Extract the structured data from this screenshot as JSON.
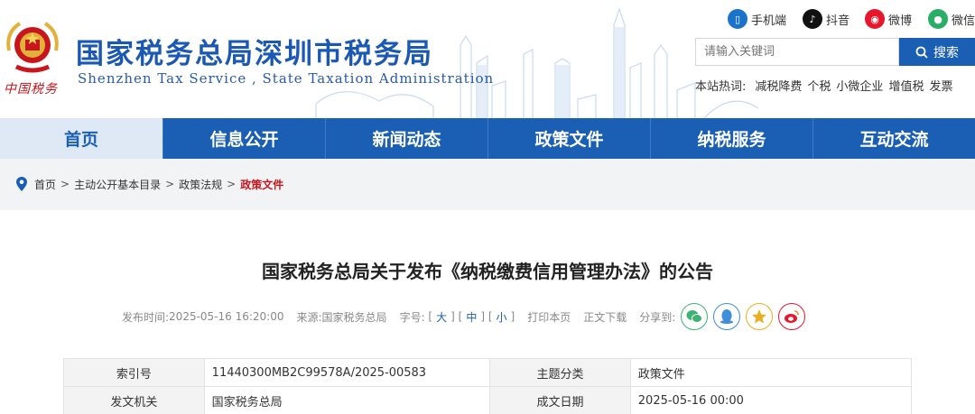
{
  "header": {
    "title": "国家税务总局深圳市税务局",
    "subtitle": "Shenzhen Tax Service , State Taxation Administration",
    "emblem_text": "中国税务",
    "social": [
      {
        "label": "手机端",
        "icon": "mobile-icon"
      },
      {
        "label": "抖音",
        "icon": "douyin-icon"
      },
      {
        "label": "微博",
        "icon": "weibo-icon"
      },
      {
        "label": "微信",
        "icon": "wechat-icon"
      }
    ],
    "search": {
      "placeholder": "请输入关键词",
      "button": "搜索"
    },
    "hot": {
      "label": "本站热词:",
      "items": [
        "减税降费",
        "个税",
        "小微企业",
        "增值税",
        "发票"
      ]
    }
  },
  "nav": {
    "items": [
      "首页",
      "信息公开",
      "新闻动态",
      "政策文件",
      "纳税服务",
      "互动交流"
    ],
    "active_index": 0
  },
  "breadcrumb": {
    "items": [
      "首页",
      "主动公开基本目录",
      "政策法规"
    ],
    "current": "政策文件",
    "separator": ">"
  },
  "article": {
    "title": "国家税务总局关于发布《纳税缴费信用管理办法》的公告",
    "meta": {
      "publish_label": "发布时间:",
      "publish_time": "2025-05-16 16:20:00",
      "source_label": "来源:",
      "source": "国家税务总局",
      "font_label": "字号:",
      "font_sizes": [
        "大",
        "中",
        "小"
      ],
      "print": "打印本页",
      "download": "正文下载",
      "share_label": "分享到:"
    },
    "info": [
      [
        {
          "label": "索引号",
          "value": "11440300MB2C99578A/2025-00583"
        },
        {
          "label": "主题分类",
          "value": "政策文件"
        }
      ],
      [
        {
          "label": "发文机关",
          "value": "国家税务总局"
        },
        {
          "label": "成文日期",
          "value": "2025-05-16 00:00"
        }
      ]
    ]
  },
  "colors": {
    "brand_blue": "#1a5fb4",
    "title_blue": "#1a58b3",
    "current_red": "#c8161d",
    "nav_active_bg": "#dfe9f6"
  }
}
